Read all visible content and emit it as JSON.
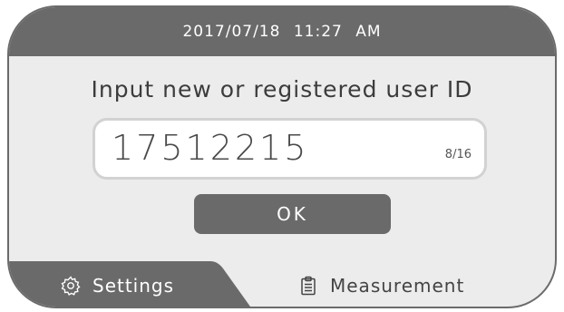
{
  "header": {
    "datetime": "2017/07/18   11:27 AM"
  },
  "main": {
    "prompt": "Input new or registered user ID",
    "user_id_value": "17512215",
    "char_count": "8/16",
    "ok_label": "OK"
  },
  "tabs": {
    "settings_label": "Settings",
    "settings_icon": "gear-icon",
    "measurement_label": "Measurement",
    "measurement_icon": "clipboard-icon"
  },
  "colors": {
    "bar_dark": "#6a6a6a",
    "screen_bg": "#ececec",
    "text_dark": "#3c3c3c",
    "field_bg": "#ffffff",
    "field_border": "#d2d2d2"
  }
}
